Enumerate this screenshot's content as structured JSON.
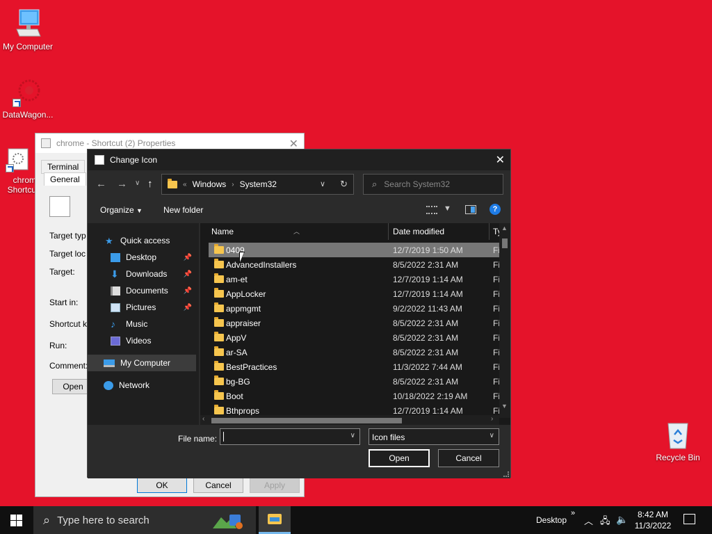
{
  "desktop": {
    "icons": [
      {
        "label": "My Computer"
      },
      {
        "label": "DataWagon..."
      },
      {
        "label": "chrom Shortcu"
      },
      {
        "label": "Recycle Bin"
      }
    ]
  },
  "properties_window": {
    "title": "chrome - Shortcut (2) Properties",
    "tabs": [
      "Terminal",
      "General"
    ],
    "fields": [
      "Target typ",
      "Target loc",
      "Target:",
      "Start in:",
      "Shortcut k",
      "Run:",
      "Comment:"
    ],
    "open_button": "Open",
    "buttons": {
      "ok": "OK",
      "cancel": "Cancel",
      "apply": "Apply"
    }
  },
  "dialog": {
    "title": "Change Icon",
    "address": {
      "overflow": "«",
      "crumbs": [
        "Windows",
        "System32"
      ]
    },
    "search_placeholder": "Search System32",
    "toolbar": {
      "organize": "Organize",
      "new_folder": "New folder"
    },
    "nav": [
      {
        "label": "Quick access"
      },
      {
        "label": "Desktop",
        "pinned": true
      },
      {
        "label": "Downloads",
        "pinned": true
      },
      {
        "label": "Documents",
        "pinned": true
      },
      {
        "label": "Pictures",
        "pinned": true
      },
      {
        "label": "Music"
      },
      {
        "label": "Videos"
      },
      {
        "label": "My Computer",
        "selected": true
      },
      {
        "label": "Network"
      }
    ],
    "columns": [
      "Name",
      "Date modified",
      "Ty"
    ],
    "files": [
      {
        "name": "0409",
        "date": "12/7/2019 1:50 AM",
        "type": "Fi",
        "selected": true
      },
      {
        "name": "AdvancedInstallers",
        "date": "8/5/2022 2:31 AM",
        "type": "Fi"
      },
      {
        "name": "am-et",
        "date": "12/7/2019 1:14 AM",
        "type": "Fi"
      },
      {
        "name": "AppLocker",
        "date": "12/7/2019 1:14 AM",
        "type": "Fi"
      },
      {
        "name": "appmgmt",
        "date": "9/2/2022 11:43 AM",
        "type": "Fi"
      },
      {
        "name": "appraiser",
        "date": "8/5/2022 2:31 AM",
        "type": "Fi"
      },
      {
        "name": "AppV",
        "date": "8/5/2022 2:31 AM",
        "type": "Fi"
      },
      {
        "name": "ar-SA",
        "date": "8/5/2022 2:31 AM",
        "type": "Fi"
      },
      {
        "name": "BestPractices",
        "date": "11/3/2022 7:44 AM",
        "type": "Fi"
      },
      {
        "name": "bg-BG",
        "date": "8/5/2022 2:31 AM",
        "type": "Fi"
      },
      {
        "name": "Boot",
        "date": "10/18/2022 2:19 AM",
        "type": "Fi"
      },
      {
        "name": "Bthprops",
        "date": "12/7/2019 1:14 AM",
        "type": "Fi"
      }
    ],
    "file_name_label": "File name:",
    "file_name_value": "",
    "file_type": "Icon files",
    "buttons": {
      "open": "Open",
      "cancel": "Cancel"
    }
  },
  "taskbar": {
    "search_placeholder": "Type here to search",
    "desktop_label": "Desktop",
    "chevron": "»",
    "time": "8:42 AM",
    "date": "11/3/2022"
  }
}
